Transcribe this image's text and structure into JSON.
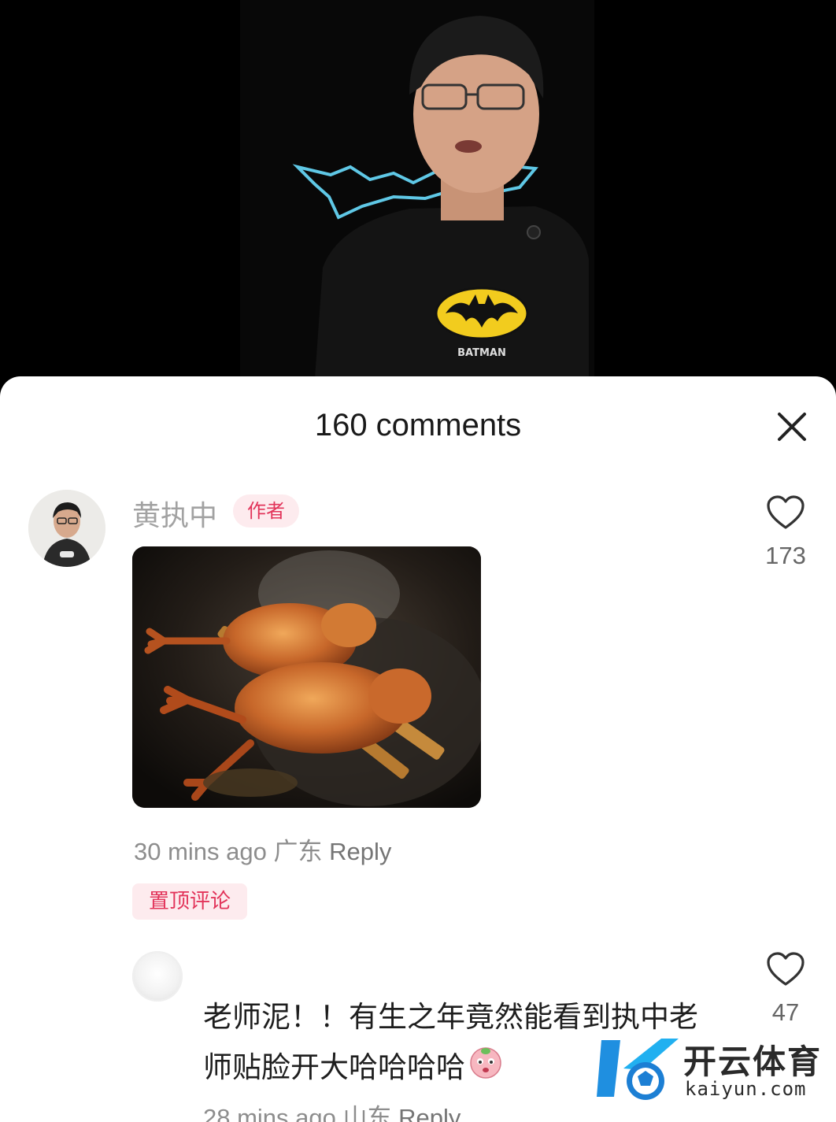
{
  "video": {
    "shirt_text": "BATMAN"
  },
  "sheet": {
    "title": "160 comments",
    "close_icon": "close-icon"
  },
  "comments": [
    {
      "username": "黄执中",
      "badge": "作者",
      "likes": "173",
      "time": "30 mins ago",
      "location": "广东",
      "reply": "Reply",
      "pinned_label": "置顶评论",
      "image": "roast-chicken-photo"
    },
    {
      "username": "",
      "text": "老师泥！！有生之年竟然能看到执中老师贴脸开大哈哈哈哈",
      "likes": "47",
      "time": "28 mins ago",
      "location": "山东",
      "reply": "Reply"
    }
  ],
  "watermark": {
    "name": "开云体育",
    "url": "kaiyun.com"
  },
  "colors": {
    "accent": "#e2345a",
    "badge_bg": "#fdebee",
    "muted": "#8d8d8d"
  }
}
